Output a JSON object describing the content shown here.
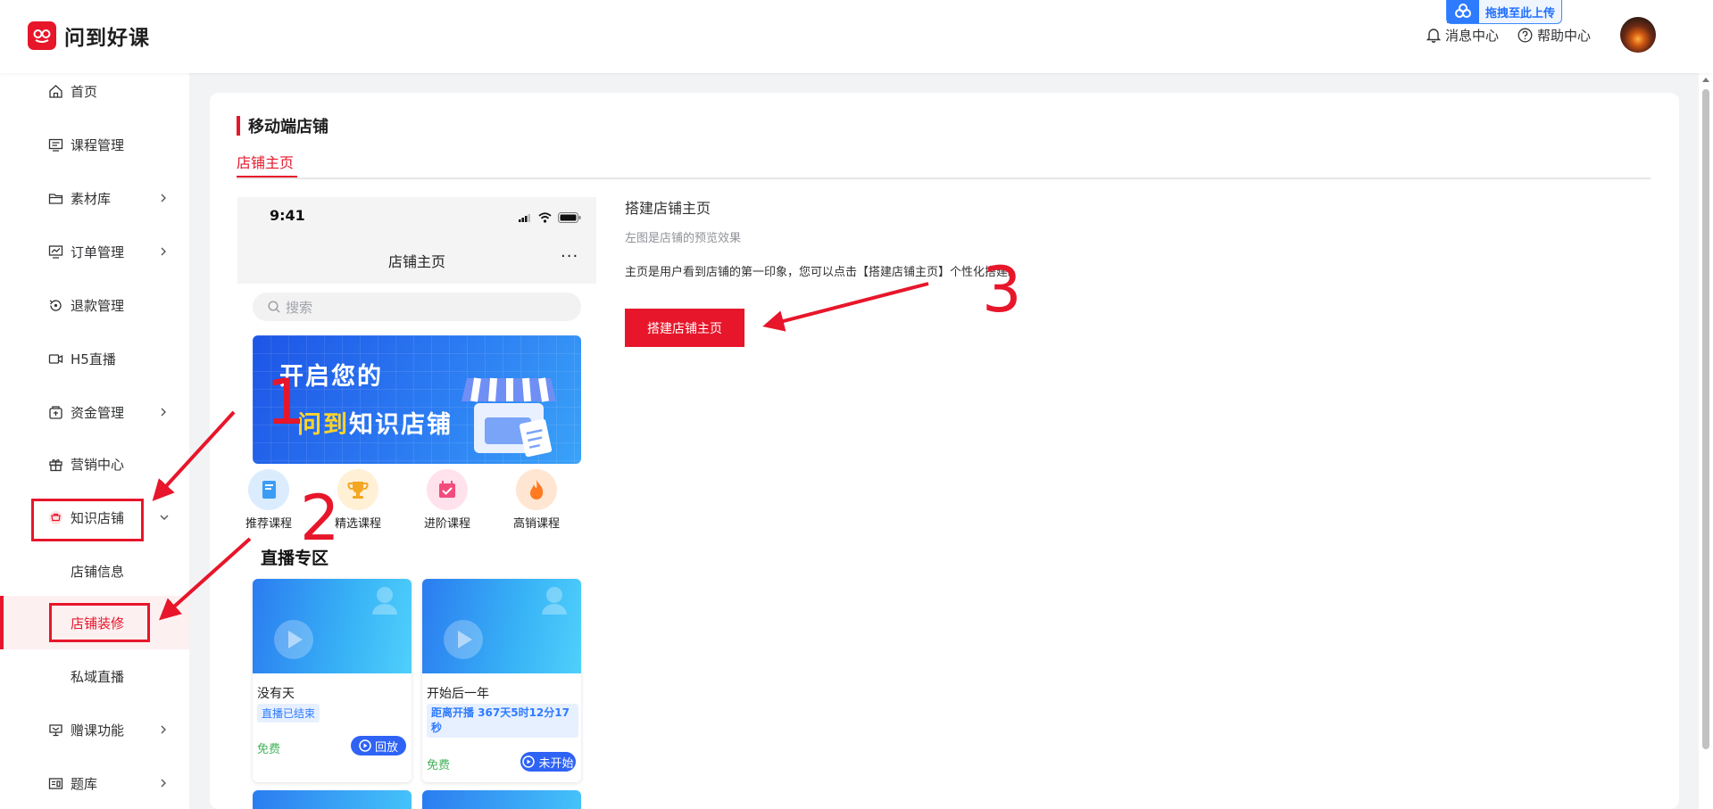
{
  "header": {
    "logo_text": "问到好课",
    "upload_label": "拖拽至此上传",
    "message_center": "消息中心",
    "help_center": "帮助中心"
  },
  "sidebar": {
    "items": [
      {
        "label": "首页",
        "icon": "home-icon"
      },
      {
        "label": "课程管理",
        "icon": "course-icon"
      },
      {
        "label": "素材库",
        "icon": "folder-icon"
      },
      {
        "label": "订单管理",
        "icon": "order-icon"
      },
      {
        "label": "退款管理",
        "icon": "refund-icon"
      },
      {
        "label": "H5直播",
        "icon": "video-icon"
      },
      {
        "label": "资金管理",
        "icon": "wallet-icon"
      },
      {
        "label": "营销中心",
        "icon": "gift-icon"
      },
      {
        "label": "知识店铺",
        "icon": "shop-icon"
      },
      {
        "label": "店铺信息"
      },
      {
        "label": "店铺装修"
      },
      {
        "label": "私域直播"
      },
      {
        "label": "赠课功能",
        "icon": "present-icon"
      },
      {
        "label": "题库",
        "icon": "question-bank-icon"
      }
    ]
  },
  "main": {
    "section_title": "移动端店铺",
    "tab_active": "店铺主页"
  },
  "phone": {
    "status_time": "9:41",
    "title": "店铺主页",
    "more": "···",
    "search_placeholder": "搜索",
    "banner_line1": "开启您的",
    "banner_line2_highlight": "问到",
    "banner_line2_rest": "知识店铺",
    "categories": [
      "推荐课程",
      "精选课程",
      "进阶课程",
      "高销课程"
    ],
    "live_section_title": "直播专区",
    "live_cards": [
      {
        "title": "没有天",
        "status": "直播已结束",
        "price": "免费",
        "button": "回放"
      },
      {
        "title": "开始后一年",
        "status": "距离开播 367天5时12分17秒",
        "price": "免费",
        "button": "未开始"
      }
    ]
  },
  "info": {
    "title": "搭建店铺主页",
    "subtitle": "左图是店铺的预览效果",
    "description": "主页是用户看到店铺的第一印象，您可以点击【搭建店铺主页】个性化搭建。",
    "button_label": "搭建店铺主页"
  },
  "annotations": {
    "step1": "1",
    "step2": "2",
    "step3": "3",
    "color": "#e7162a"
  },
  "colors": {
    "accent": "#e7162a",
    "blue": "#2f7bff"
  }
}
